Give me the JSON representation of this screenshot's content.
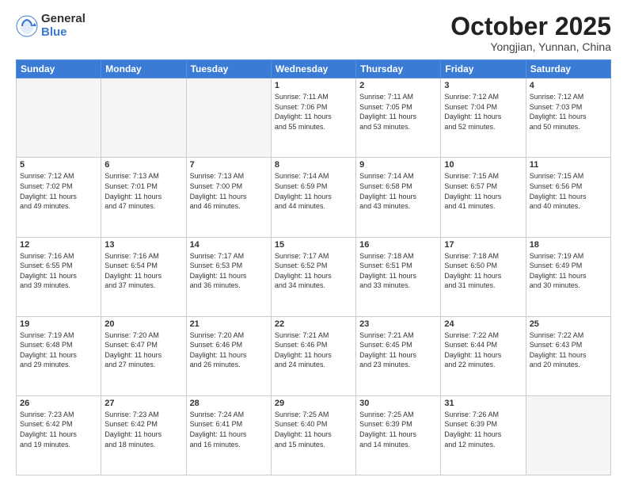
{
  "logo": {
    "general": "General",
    "blue": "Blue"
  },
  "title": "October 2025",
  "subtitle": "Yongjian, Yunnan, China",
  "weekdays": [
    "Sunday",
    "Monday",
    "Tuesday",
    "Wednesday",
    "Thursday",
    "Friday",
    "Saturday"
  ],
  "weeks": [
    [
      {
        "day": "",
        "info": ""
      },
      {
        "day": "",
        "info": ""
      },
      {
        "day": "",
        "info": ""
      },
      {
        "day": "1",
        "info": "Sunrise: 7:11 AM\nSunset: 7:06 PM\nDaylight: 11 hours\nand 55 minutes."
      },
      {
        "day": "2",
        "info": "Sunrise: 7:11 AM\nSunset: 7:05 PM\nDaylight: 11 hours\nand 53 minutes."
      },
      {
        "day": "3",
        "info": "Sunrise: 7:12 AM\nSunset: 7:04 PM\nDaylight: 11 hours\nand 52 minutes."
      },
      {
        "day": "4",
        "info": "Sunrise: 7:12 AM\nSunset: 7:03 PM\nDaylight: 11 hours\nand 50 minutes."
      }
    ],
    [
      {
        "day": "5",
        "info": "Sunrise: 7:12 AM\nSunset: 7:02 PM\nDaylight: 11 hours\nand 49 minutes."
      },
      {
        "day": "6",
        "info": "Sunrise: 7:13 AM\nSunset: 7:01 PM\nDaylight: 11 hours\nand 47 minutes."
      },
      {
        "day": "7",
        "info": "Sunrise: 7:13 AM\nSunset: 7:00 PM\nDaylight: 11 hours\nand 46 minutes."
      },
      {
        "day": "8",
        "info": "Sunrise: 7:14 AM\nSunset: 6:59 PM\nDaylight: 11 hours\nand 44 minutes."
      },
      {
        "day": "9",
        "info": "Sunrise: 7:14 AM\nSunset: 6:58 PM\nDaylight: 11 hours\nand 43 minutes."
      },
      {
        "day": "10",
        "info": "Sunrise: 7:15 AM\nSunset: 6:57 PM\nDaylight: 11 hours\nand 41 minutes."
      },
      {
        "day": "11",
        "info": "Sunrise: 7:15 AM\nSunset: 6:56 PM\nDaylight: 11 hours\nand 40 minutes."
      }
    ],
    [
      {
        "day": "12",
        "info": "Sunrise: 7:16 AM\nSunset: 6:55 PM\nDaylight: 11 hours\nand 39 minutes."
      },
      {
        "day": "13",
        "info": "Sunrise: 7:16 AM\nSunset: 6:54 PM\nDaylight: 11 hours\nand 37 minutes."
      },
      {
        "day": "14",
        "info": "Sunrise: 7:17 AM\nSunset: 6:53 PM\nDaylight: 11 hours\nand 36 minutes."
      },
      {
        "day": "15",
        "info": "Sunrise: 7:17 AM\nSunset: 6:52 PM\nDaylight: 11 hours\nand 34 minutes."
      },
      {
        "day": "16",
        "info": "Sunrise: 7:18 AM\nSunset: 6:51 PM\nDaylight: 11 hours\nand 33 minutes."
      },
      {
        "day": "17",
        "info": "Sunrise: 7:18 AM\nSunset: 6:50 PM\nDaylight: 11 hours\nand 31 minutes."
      },
      {
        "day": "18",
        "info": "Sunrise: 7:19 AM\nSunset: 6:49 PM\nDaylight: 11 hours\nand 30 minutes."
      }
    ],
    [
      {
        "day": "19",
        "info": "Sunrise: 7:19 AM\nSunset: 6:48 PM\nDaylight: 11 hours\nand 29 minutes."
      },
      {
        "day": "20",
        "info": "Sunrise: 7:20 AM\nSunset: 6:47 PM\nDaylight: 11 hours\nand 27 minutes."
      },
      {
        "day": "21",
        "info": "Sunrise: 7:20 AM\nSunset: 6:46 PM\nDaylight: 11 hours\nand 26 minutes."
      },
      {
        "day": "22",
        "info": "Sunrise: 7:21 AM\nSunset: 6:46 PM\nDaylight: 11 hours\nand 24 minutes."
      },
      {
        "day": "23",
        "info": "Sunrise: 7:21 AM\nSunset: 6:45 PM\nDaylight: 11 hours\nand 23 minutes."
      },
      {
        "day": "24",
        "info": "Sunrise: 7:22 AM\nSunset: 6:44 PM\nDaylight: 11 hours\nand 22 minutes."
      },
      {
        "day": "25",
        "info": "Sunrise: 7:22 AM\nSunset: 6:43 PM\nDaylight: 11 hours\nand 20 minutes."
      }
    ],
    [
      {
        "day": "26",
        "info": "Sunrise: 7:23 AM\nSunset: 6:42 PM\nDaylight: 11 hours\nand 19 minutes."
      },
      {
        "day": "27",
        "info": "Sunrise: 7:23 AM\nSunset: 6:42 PM\nDaylight: 11 hours\nand 18 minutes."
      },
      {
        "day": "28",
        "info": "Sunrise: 7:24 AM\nSunset: 6:41 PM\nDaylight: 11 hours\nand 16 minutes."
      },
      {
        "day": "29",
        "info": "Sunrise: 7:25 AM\nSunset: 6:40 PM\nDaylight: 11 hours\nand 15 minutes."
      },
      {
        "day": "30",
        "info": "Sunrise: 7:25 AM\nSunset: 6:39 PM\nDaylight: 11 hours\nand 14 minutes."
      },
      {
        "day": "31",
        "info": "Sunrise: 7:26 AM\nSunset: 6:39 PM\nDaylight: 11 hours\nand 12 minutes."
      },
      {
        "day": "",
        "info": ""
      }
    ]
  ]
}
